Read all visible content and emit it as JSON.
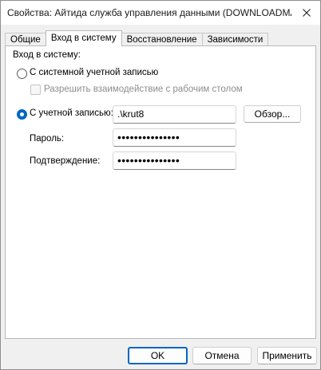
{
  "window": {
    "title": "Свойства: Айтида служба управления данными (DOWNLOADMA..."
  },
  "tabs": [
    {
      "label": "Общие"
    },
    {
      "label": "Вход в систему"
    },
    {
      "label": "Восстановление"
    },
    {
      "label": "Зависимости"
    }
  ],
  "logon": {
    "group_label": "Вход в систему:",
    "system_account_label": "С системной учетной записью",
    "allow_desktop_label": "Разрешить взаимодействие с рабочим столом",
    "this_account_label": "С учетной записью:",
    "account_value": ".\\krut8",
    "browse_label": "Обзор...",
    "password_label": "Пароль:",
    "password_value": "•••••••••••••••",
    "confirm_label": "Подтверждение:",
    "confirm_value": "•••••••••••••••",
    "selected_option": "this_account"
  },
  "footer": {
    "ok_label": "OK",
    "cancel_label": "Отмена",
    "apply_label": "Применить"
  },
  "colors": {
    "accent": "#0067c0"
  }
}
